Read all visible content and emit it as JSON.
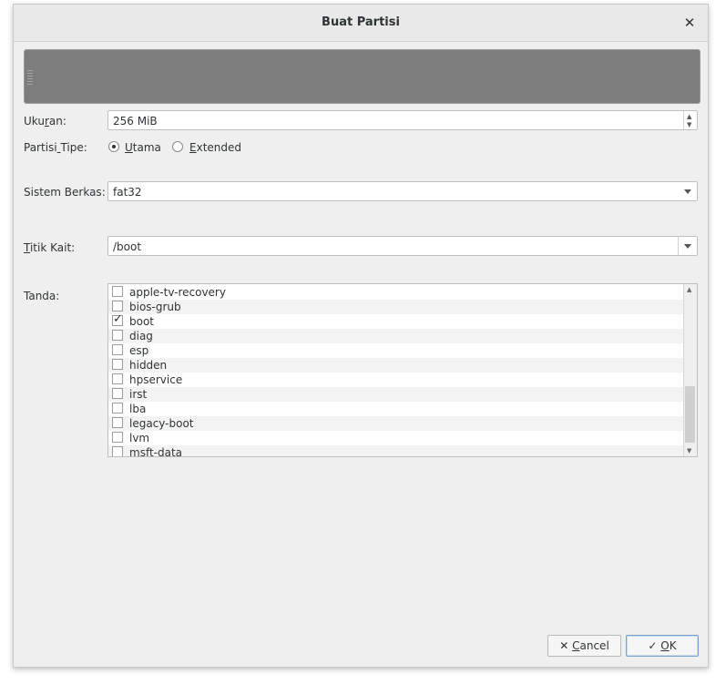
{
  "window": {
    "title": "Buat Partisi"
  },
  "icons": {
    "close": "close-icon",
    "cancel": "x-icon",
    "ok": "check-icon"
  },
  "size": {
    "label_pre": "Uku",
    "label_u": "r",
    "label_post": "an:",
    "value": "256 MiB"
  },
  "ptype": {
    "label_pre": "Partisi",
    "label_u": " ",
    "label_post": "Tipe:",
    "options": [
      {
        "label_u": "U",
        "label_rest": "tama",
        "selected": true
      },
      {
        "label_u": "E",
        "label_rest": "xtended",
        "selected": false
      }
    ]
  },
  "filesystem": {
    "label": "Sistem Berkas:",
    "value": "fat32"
  },
  "mount": {
    "label_u": "T",
    "label_rest": "itik Kait:",
    "value": "/boot"
  },
  "flags": {
    "label": "Tanda:",
    "items": [
      {
        "label": "apple-tv-recovery",
        "checked": false
      },
      {
        "label": "bios-grub",
        "checked": false
      },
      {
        "label": "boot",
        "checked": true
      },
      {
        "label": "diag",
        "checked": false
      },
      {
        "label": "esp",
        "checked": false
      },
      {
        "label": "hidden",
        "checked": false
      },
      {
        "label": "hpservice",
        "checked": false
      },
      {
        "label": "irst",
        "checked": false
      },
      {
        "label": "lba",
        "checked": false
      },
      {
        "label": "legacy-boot",
        "checked": false
      },
      {
        "label": "lvm",
        "checked": false
      },
      {
        "label": "msft-data",
        "checked": false
      }
    ]
  },
  "buttons": {
    "cancel_u": "C",
    "cancel_rest": "ancel",
    "ok_u": "O",
    "ok_rest": "K"
  },
  "colors": {
    "preview": "#7d7d7d",
    "ok_border": "#7aa2cf"
  }
}
